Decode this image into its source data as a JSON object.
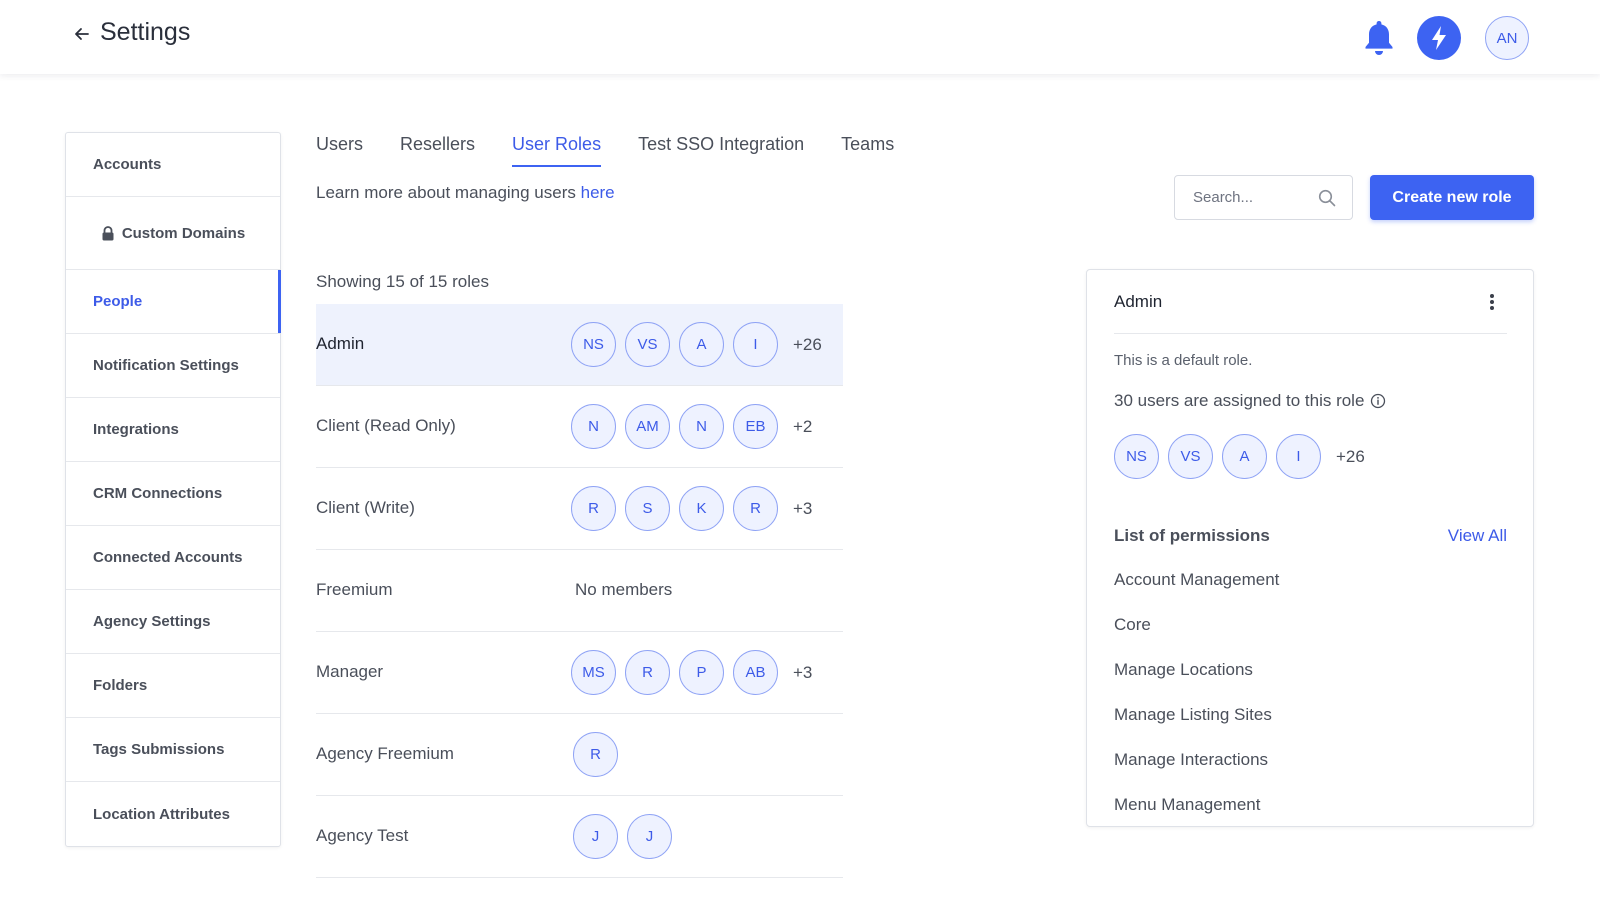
{
  "header": {
    "title": "Settings",
    "user_initials": "AN"
  },
  "sidebar": {
    "items": [
      {
        "label": "Accounts"
      },
      {
        "label": "Custom Domains"
      },
      {
        "label": "People"
      },
      {
        "label": "Notification Settings"
      },
      {
        "label": "Integrations"
      },
      {
        "label": "CRM Connections"
      },
      {
        "label": "Connected Accounts"
      },
      {
        "label": "Agency Settings"
      },
      {
        "label": "Folders"
      },
      {
        "label": "Tags Submissions"
      },
      {
        "label": "Location Attributes"
      }
    ]
  },
  "tabs": [
    {
      "label": "Users"
    },
    {
      "label": "Resellers"
    },
    {
      "label": "User Roles"
    },
    {
      "label": "Test SSO Integration"
    },
    {
      "label": "Teams"
    }
  ],
  "learn_more": {
    "text": "Learn more about managing users ",
    "link": "here"
  },
  "search": {
    "placeholder": "Search..."
  },
  "create_button": "Create new role",
  "roles_summary": "Showing 15 of 15 roles",
  "roles": [
    {
      "name": "Admin",
      "members": [
        "NS",
        "VS",
        "A",
        "I"
      ],
      "more": "+26"
    },
    {
      "name": "Client (Read Only)",
      "members": [
        "N",
        "AM",
        "N",
        "EB"
      ],
      "more": "+2"
    },
    {
      "name": "Client (Write)",
      "members": [
        "R",
        "S",
        "K",
        "R"
      ],
      "more": "+3"
    },
    {
      "name": "Freemium",
      "members": [],
      "empty_label": "No members"
    },
    {
      "name": "Manager",
      "members": [
        "MS",
        "R",
        "P",
        "AB"
      ],
      "more": "+3"
    },
    {
      "name": "Agency Freemium",
      "members": [
        "R"
      ]
    },
    {
      "name": "Agency Test",
      "members": [
        "J",
        "J"
      ]
    }
  ],
  "detail": {
    "title": "Admin",
    "default_text": "This is a default role.",
    "assigned_text": "30 users are assigned to this role",
    "members": [
      "NS",
      "VS",
      "A",
      "I"
    ],
    "more": "+26",
    "permissions_title": "List of permissions",
    "view_all": "View All",
    "permissions": [
      "Account Management",
      "Core",
      "Manage Locations",
      "Manage Listing Sites",
      "Manage Interactions",
      "Menu Management"
    ]
  },
  "colors": {
    "accent": "#3d63f2",
    "selected_row": "#eef2fd"
  }
}
